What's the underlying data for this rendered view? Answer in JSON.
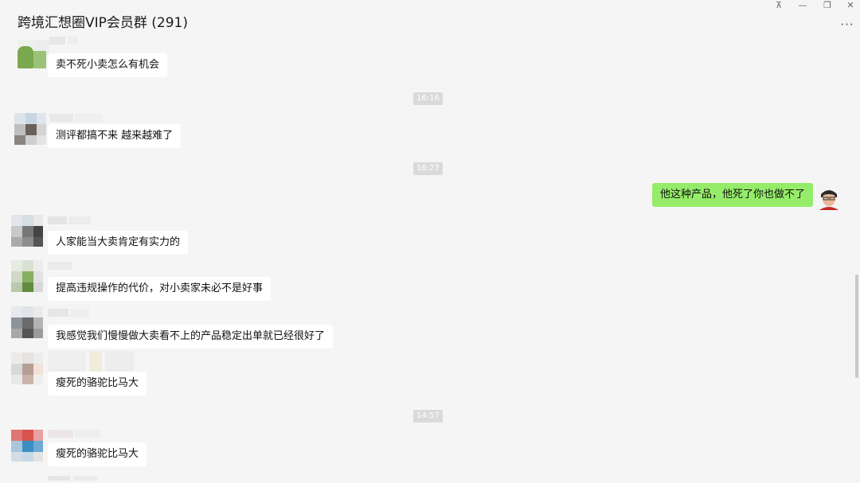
{
  "chat": {
    "title": "跨境汇想圈VIP会员群 (291)"
  },
  "window_controls": {
    "pin": "⊼",
    "minimize": "—",
    "restore": "❐",
    "close": "✕"
  },
  "more_button": "···",
  "messages": [
    {
      "text": "卖不死小卖怎么有机会"
    },
    {
      "text": "测评都搞不来 越来越难了"
    },
    {
      "text": "他这种产品，他死了你也做不了"
    },
    {
      "text": "人家能当大卖肯定有实力的"
    },
    {
      "text": "提高违规操作的代价，对小卖家未必不是好事"
    },
    {
      "text": "我感觉我们慢慢做大卖看不上的产品稳定出单就已经很好了"
    },
    {
      "text": "瘦死的骆驼比马大"
    },
    {
      "text": "瘦死的骆驼比马大"
    }
  ],
  "timestamps": [
    "16:16",
    "16:27",
    "14:57"
  ],
  "colors": {
    "self_bubble": "#95ec69",
    "other_bubble": "#ffffff",
    "background": "#f5f5f5"
  }
}
